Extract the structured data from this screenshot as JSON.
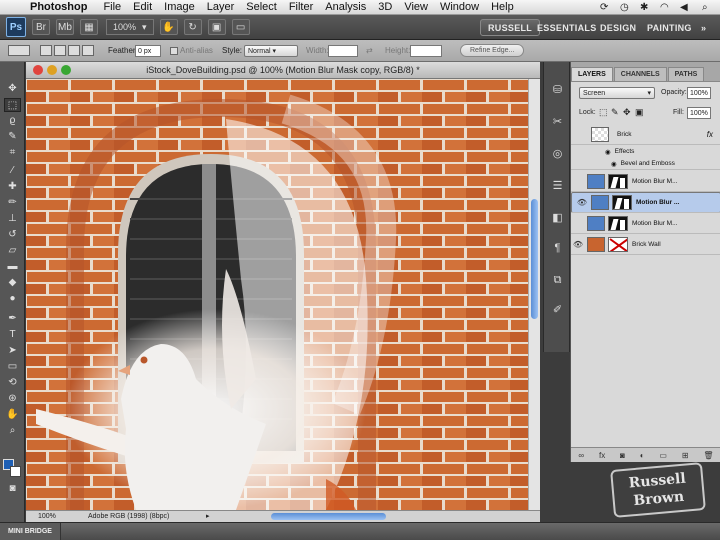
{
  "menubar": {
    "app": "Photoshop",
    "items": [
      "File",
      "Edit",
      "Image",
      "Layer",
      "Select",
      "Filter",
      "Analysis",
      "3D",
      "View",
      "Window",
      "Help"
    ]
  },
  "appbar": {
    "badge": "Ps",
    "zoom": "100%",
    "workspaces": [
      "RUSSELL",
      "ESSENTIALS",
      "DESIGN",
      "PAINTING"
    ],
    "active_workspace": "RUSSELL"
  },
  "options": {
    "feather_label": "Feather:",
    "feather_value": "0 px",
    "antialias": "Anti-alias",
    "style_label": "Style:",
    "style_value": "Normal",
    "width_label": "Width:",
    "height_label": "Height:",
    "refine_edge": "Refine Edge..."
  },
  "document": {
    "title": "iStock_DoveBuilding.psd @ 100% (Motion Blur Mask copy, RGB/8) *",
    "zoom": "100%",
    "profile": "Adobe RGB (1998) (8bpc)"
  },
  "layers_panel": {
    "tabs": [
      "LAYERS",
      "CHANNELS",
      "PATHS"
    ],
    "blend_mode": "Screen",
    "opacity_label": "Opacity:",
    "opacity_value": "100%",
    "lock_label": "Lock:",
    "fill_label": "Fill:",
    "fill_value": "100%",
    "layers": [
      {
        "name": "Brick",
        "fx": "fx"
      },
      {
        "name": "Effects"
      },
      {
        "name": "Bevel and Emboss"
      },
      {
        "name": "Motion Blur M..."
      },
      {
        "name": "Motion Blur ...",
        "selected": true
      },
      {
        "name": "Motion Blur M..."
      },
      {
        "name": "Brick Wall"
      }
    ]
  },
  "minibridge": {
    "label": "MINI BRIDGE"
  },
  "watermark": {
    "line1": "Russell",
    "line2": "Brown"
  },
  "colors": {
    "brick": "#c8642f",
    "mortar": "#e8d8c8",
    "selection": "#b6cbeb",
    "accent": "#5b8fd6"
  }
}
